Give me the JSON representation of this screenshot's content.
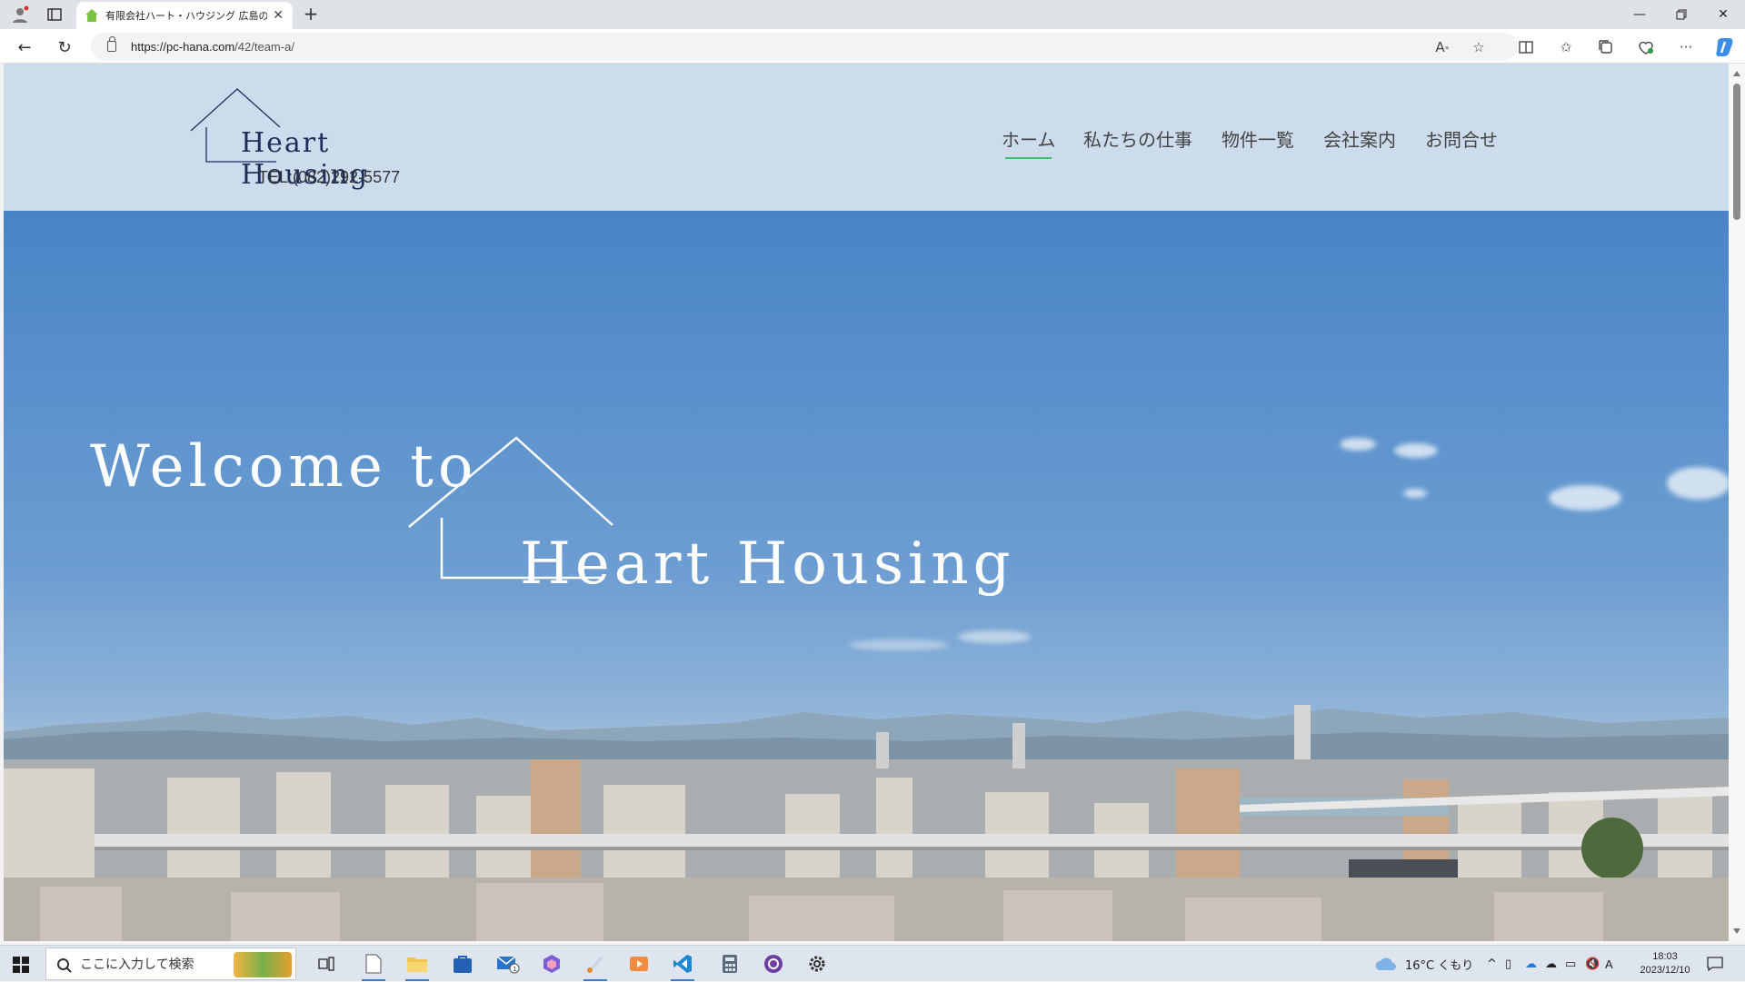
{
  "browser": {
    "tab_title": "有限会社ハート・ハウジング 広島の",
    "url_host": "https://pc-hana.com",
    "url_path": "/42/team-a/"
  },
  "site": {
    "logo_name": "Heart Housing",
    "tel": "TEL:(082)292-5577",
    "nav": [
      {
        "label": "ホーム",
        "active": true
      },
      {
        "label": "私たちの仕事",
        "active": false
      },
      {
        "label": "物件一覧",
        "active": false
      },
      {
        "label": "会社案内",
        "active": false
      },
      {
        "label": "お問合せ",
        "active": false
      }
    ],
    "nav_active_color": "#3fbf6a",
    "header_bg": "#ccdcec"
  },
  "hero": {
    "welcome": "Welcome to",
    "name": "Heart Housing"
  },
  "taskbar": {
    "search_placeholder": "ここに入力して検索",
    "weather": "16°C くもり",
    "time": "18:03",
    "date": "2023/12/10",
    "ime": "A"
  }
}
